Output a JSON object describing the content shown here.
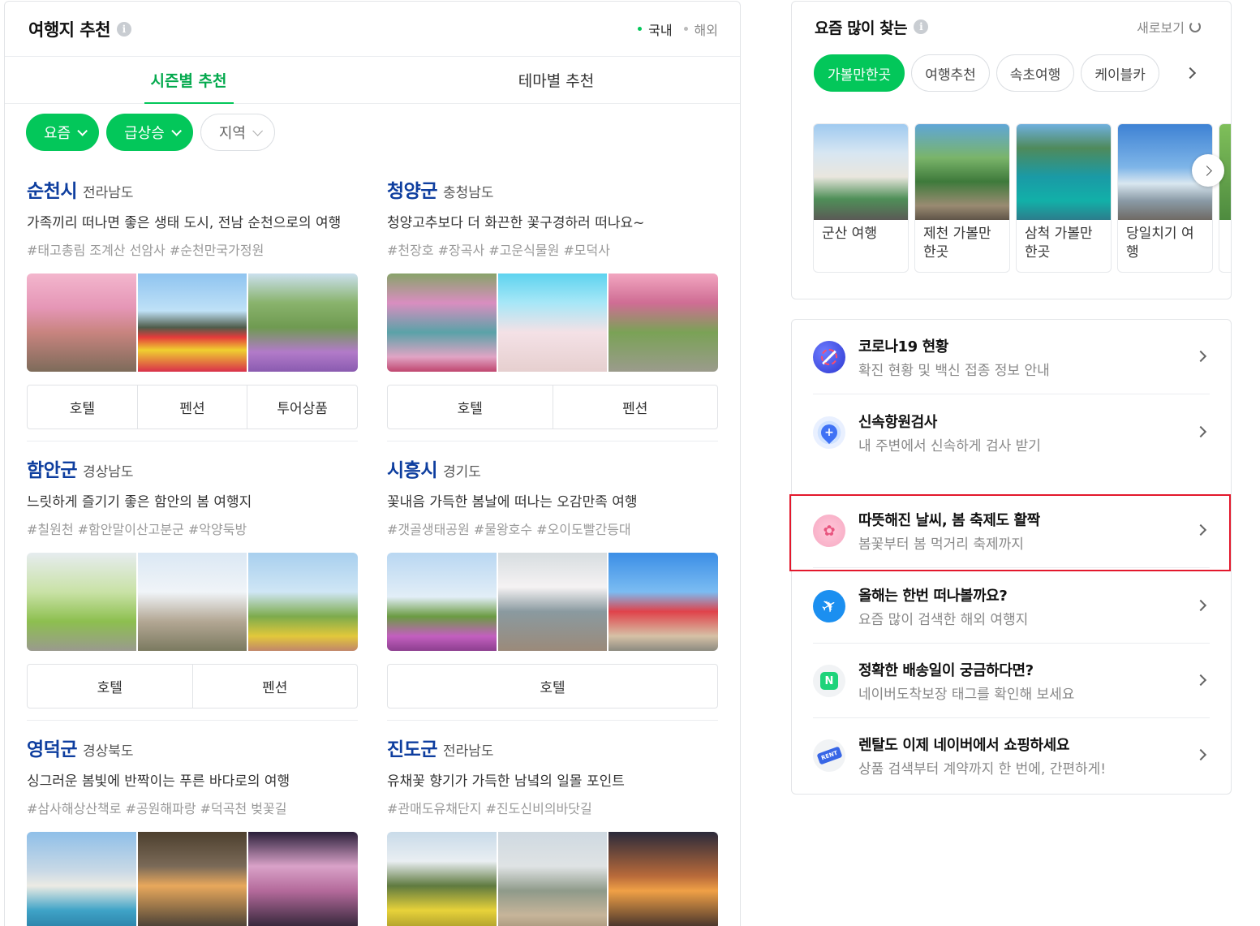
{
  "travel": {
    "title": "여행지 추천",
    "region_options": [
      {
        "label": "국내",
        "active": true
      },
      {
        "label": "해외",
        "active": false
      }
    ],
    "tabs": [
      {
        "label": "시즌별 추천",
        "active": true
      },
      {
        "label": "테마별 추천",
        "active": false
      }
    ],
    "filters": [
      {
        "label": "요즘",
        "on": true
      },
      {
        "label": "급상승",
        "on": true
      },
      {
        "label": "지역",
        "on": false
      }
    ],
    "cards": [
      {
        "city": "순천시",
        "province": "전라남도",
        "desc": "가족끼리 떠나면 좋은 생태 도시, 전남 순천으로의 여행",
        "tags": "#태고총림 조계산 선암사 #순천만국가정원",
        "images": [
          "blossom-street",
          "windmill",
          "garden-purple"
        ],
        "buttons": [
          "호텔",
          "펜션",
          "투어상품"
        ]
      },
      {
        "city": "청양군",
        "province": "충청남도",
        "desc": "청양고추보다 더 화끈한 꽃구경하러 떠나요~",
        "tags": "#천장호 #장곡사 #고운식물원 #모덕사",
        "images": [
          "lake-bridge",
          "blossom-sky",
          "flower-tunnel"
        ],
        "buttons": [
          "호텔",
          "펜션"
        ]
      },
      {
        "city": "함안군",
        "province": "경상남도",
        "desc": "느릿하게 즐기기 좋은 함안의 봄 여행지",
        "tags": "#칠원천 #함안말이산고분군 #악양둑방",
        "images": [
          "stream",
          "lone-tree",
          "red-windmill"
        ],
        "buttons": [
          "호텔",
          "펜션"
        ]
      },
      {
        "city": "시흥시",
        "province": "경기도",
        "desc": "꽃내음 가득한 봄날에 떠나는 오감만족 여행",
        "tags": "#갯골생태공원 #물왕호수 #오이도빨간등대",
        "images": [
          "tower-field",
          "pier",
          "lighthouse"
        ],
        "buttons": [
          "호텔"
        ]
      },
      {
        "city": "영덕군",
        "province": "경상북도",
        "desc": "싱그러운 봄빛에 반짝이는 푸른 바다로의 여행",
        "tags": "#삼사해상산책로 #공원해파랑 #덕곡천 벚꽃길",
        "images": [
          "coast-town",
          "sculpture-sunset",
          "night-blossom"
        ],
        "buttons": []
      },
      {
        "city": "진도군",
        "province": "전라남도",
        "desc": "유채꽃 향기가 가득한 남녘의 일몰 포인트",
        "tags": "#관매도유채단지 #진도신비의바닷길",
        "images": [
          "yellow-field",
          "sea-road",
          "sunset-sea"
        ],
        "buttons": []
      }
    ]
  },
  "trending": {
    "title": "요즘 많이 찾는",
    "refresh_label": "새로보기",
    "chips": [
      {
        "label": "가볼만한곳",
        "active": true
      },
      {
        "label": "여행추천",
        "active": false
      },
      {
        "label": "속초여행",
        "active": false
      },
      {
        "label": "케이블카",
        "active": false
      }
    ],
    "cards": [
      {
        "label": "군산 여행",
        "image": "gunsan"
      },
      {
        "label": "제천 가볼만한곳",
        "image": "jecheon"
      },
      {
        "label": "삼척 가볼만한곳",
        "image": "samcheok"
      },
      {
        "label": "당일치기 여행",
        "image": "dangil"
      }
    ]
  },
  "services": [
    {
      "title": "코로나19 현황",
      "sub": "확진 현황 및 백신 접종 정보 안내",
      "icon": "covid-icon"
    },
    {
      "title": "신속항원검사",
      "sub": "내 주변에서 신속하게 검사 받기",
      "icon": "test-location-icon"
    },
    {
      "title": "따뜻해진 날씨, 봄 축제도 활짝",
      "sub": "봄꽃부터 봄 먹거리 축제까지",
      "icon": "cherry-blossom-icon"
    },
    {
      "title": "올해는 한번 떠나볼까요?",
      "sub": "요즘 많이 검색한 해외 여행지",
      "icon": "airplane-icon"
    },
    {
      "title": "정확한 배송일이 궁금하다면?",
      "sub": "네이버도착보장 태그를 확인해 보세요",
      "icon": "naver-delivery-icon"
    },
    {
      "title": "렌탈도 이제 네이버에서 쇼핑하세요",
      "sub": "상품 검색부터 계약까지 한 번에, 간편하게!",
      "icon": "rent-tag-icon"
    }
  ],
  "colors": {
    "accent": "#03c75a",
    "city": "#0e3e9f",
    "highlight": "#e3182c"
  }
}
